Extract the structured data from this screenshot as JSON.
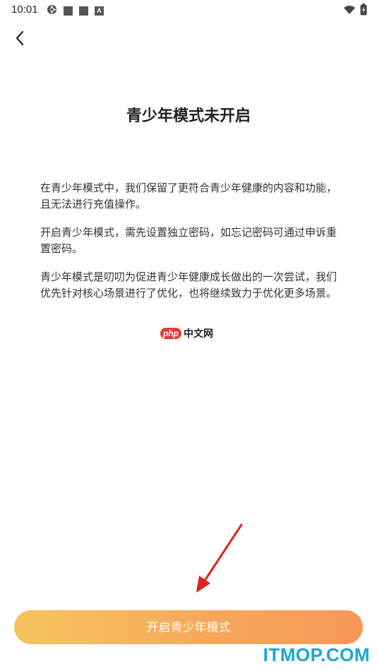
{
  "status_bar": {
    "time": "10:01",
    "icons_left": [
      "aperture-icon",
      "square-notification-icon",
      "square-notification-icon",
      "a-badge-icon"
    ],
    "icons_right": [
      "wifi-icon",
      "battery-charging-icon"
    ]
  },
  "header": {
    "back_icon": "chevron-left-icon"
  },
  "page": {
    "title": "青少年模式未开启",
    "paragraphs": [
      "在青少年模式中，我们保留了更符合青少年健康的内容和功能，且无法进行充值操作。",
      "开启青少年模式，需先设置独立密码，如忘记密码可通过申诉重置密码。",
      "青少年模式是叨叨为促进青少年健康成长做出的一次尝试，我们优先针对核心场景进行了优化，也将继续致力于优化更多场景。"
    ]
  },
  "watermarks": {
    "php_badge": "php",
    "php_text": "中文网",
    "site": "ITMOP.COM"
  },
  "actions": {
    "enable_button_label": "开启青少年模式"
  },
  "colors": {
    "button_gradient_start": "#f6c45e",
    "button_gradient_end": "#f7975a",
    "annotation_arrow": "#e02020",
    "itmop_watermark": "#19a7cf"
  }
}
